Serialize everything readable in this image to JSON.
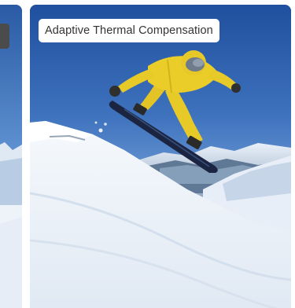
{
  "carousel": {
    "prev_card": {
      "label": "",
      "image": "snow-mountain-scene"
    },
    "current_card": {
      "label": "Adaptive Thermal Compensation",
      "image": "snowboarder-jump-photo"
    }
  },
  "colors": {
    "sky_top": "#1f4f9e",
    "sky_bottom": "#6f9fd6",
    "snow": "#f4f7fb",
    "suit_yellow": "#e7c928",
    "board": "#1b2440",
    "chip_bg": "#ffffff",
    "chip_text": "#333333",
    "prev_chip_bg": "#4b4b4b"
  }
}
